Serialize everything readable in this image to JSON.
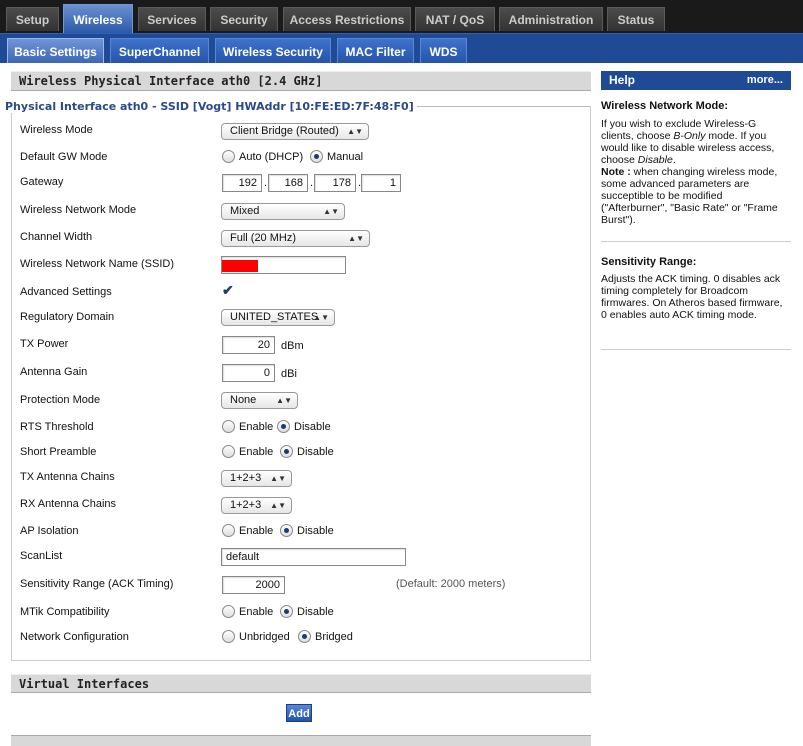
{
  "top_tabs": [
    "Setup",
    "Wireless",
    "Services",
    "Security",
    "Access Restrictions",
    "NAT / QoS",
    "Administration",
    "Status"
  ],
  "sub_tabs": [
    "Basic Settings",
    "SuperChannel",
    "Wireless Security",
    "MAC Filter",
    "WDS"
  ],
  "section_title": "Wireless Physical Interface ath0 [2.4 GHz]",
  "interface_header": "Physical Interface ath0 - SSID [Vogt] HWAddr [10:FE:ED:7F:48:F0]",
  "fields": {
    "wireless_mode": {
      "label": "Wireless Mode",
      "value": "Client Bridge (Routed)"
    },
    "default_gw_mode": {
      "label": "Default GW Mode",
      "opt1": "Auto (DHCP)",
      "opt2": "Manual"
    },
    "gateway": {
      "label": "Gateway",
      "o1": "192",
      "o2": "168",
      "o3": "178",
      "o4": "1"
    },
    "network_mode": {
      "label": "Wireless Network Mode",
      "value": "Mixed"
    },
    "channel_width": {
      "label": "Channel Width",
      "value": "Full (20 MHz)"
    },
    "ssid": {
      "label": "Wireless Network Name (SSID)",
      "value": ""
    },
    "advanced": {
      "label": "Advanced Settings"
    },
    "regdomain": {
      "label": "Regulatory Domain",
      "value": "UNITED_STATES"
    },
    "txpower": {
      "label": "TX Power",
      "value": "20",
      "unit": "dBm"
    },
    "antgain": {
      "label": "Antenna Gain",
      "value": "0",
      "unit": "dBi"
    },
    "protection": {
      "label": "Protection Mode",
      "value": "None"
    },
    "rts": {
      "label": "RTS Threshold",
      "opt1": "Enable",
      "opt2": "Disable"
    },
    "preamble": {
      "label": "Short Preamble",
      "opt1": "Enable",
      "opt2": "Disable"
    },
    "txchains": {
      "label": "TX Antenna Chains",
      "value": "1+2+3"
    },
    "rxchains": {
      "label": "RX Antenna Chains",
      "value": "1+2+3"
    },
    "apiso": {
      "label": "AP Isolation",
      "opt1": "Enable",
      "opt2": "Disable"
    },
    "scanlist": {
      "label": "ScanList",
      "value": "default"
    },
    "sens": {
      "label": "Sensitivity Range (ACK Timing)",
      "value": "2000",
      "note": "(Default: 2000 meters)"
    },
    "mtik": {
      "label": "MTik Compatibility",
      "opt1": "Enable",
      "opt2": "Disable"
    },
    "netconf": {
      "label": "Network Configuration",
      "opt1": "Unbridged",
      "opt2": "Bridged"
    }
  },
  "virtual_title": "Virtual Interfaces",
  "add_label": "Add",
  "help": {
    "title": "Help",
    "more": "more...",
    "h1": "Wireless Network Mode:",
    "p1a": "If you wish to exclude Wireless-G clients, choose ",
    "p1b": "B-Only",
    "p1c": " mode. If you would like to disable wireless access, choose ",
    "p1d": "Disable",
    "p1e": ".",
    "note_label": "Note :",
    "note_text": " when changing wireless mode, some advanced parameters are succeptible to be modified (\"Afterburner\", \"Basic Rate\" or \"Frame Burst\").",
    "h2": "Sensitivity Range:",
    "p2": "Adjusts the ACK timing. 0 disables ack timing completely for Broadcom firmwares. On Atheros based firmware, 0 enables auto ACK timing mode."
  },
  "colors": {
    "accent": "#1e4a96",
    "ssid_redaction": "#ff0000"
  }
}
